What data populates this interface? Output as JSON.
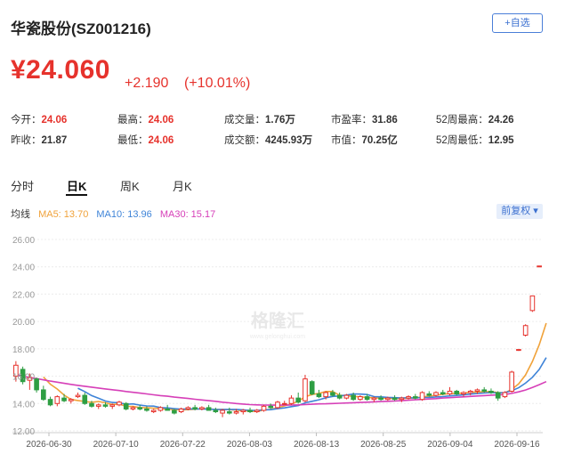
{
  "header": {
    "title": "华瓷股份(SZ001216)",
    "watch_button": "+自选"
  },
  "quote": {
    "price": "¥24.060",
    "change": "+2.190",
    "change_pct": "(+10.01%)"
  },
  "stats": {
    "open_label": "今开：",
    "open_value": "24.06",
    "high_label": "最高：",
    "high_value": "24.06",
    "volume_label": "成交量：",
    "volume_value": "1.76万",
    "pe_label": "市盈率：",
    "pe_value": "31.86",
    "wk52_high_label": "52周最高：",
    "wk52_high_value": "24.26",
    "prev_close_label": "昨收：",
    "prev_close_value": "21.87",
    "low_label": "最低：",
    "low_value": "24.06",
    "turnover_label": "成交额：",
    "turnover_value": "4245.93万",
    "mktcap_label": "市值：",
    "mktcap_value": "70.25亿",
    "wk52_low_label": "52周最低：",
    "wk52_low_value": "12.95"
  },
  "tabs": [
    "分时",
    "日K",
    "周K",
    "月K"
  ],
  "active_tab": "日K",
  "ma_legend": {
    "label": "均线",
    "ma5": "MA5: 13.70",
    "ma10": "MA10: 13.96",
    "ma30": "MA30: 15.17"
  },
  "adjust_button": "前复权",
  "watermark": "格隆汇",
  "watermark_sub": "www.gelonghui.com",
  "colors": {
    "up": "#e6322c",
    "down": "#2e9e43",
    "ma5": "#f0a23a",
    "ma10": "#3f84d8",
    "ma30": "#d63fb8",
    "accent": "#3a6fd0"
  },
  "chart_data": {
    "type": "candlestick",
    "ylim": [
      12,
      26
    ],
    "y_ticks": [
      "12.00",
      "14.00",
      "16.00",
      "18.00",
      "20.00",
      "22.00",
      "24.00",
      "26.00"
    ],
    "x_ticks": [
      "2026-06-30",
      "2026-07-10",
      "2026-07-22",
      "2026-08-03",
      "2026-08-13",
      "2026-08-25",
      "2026-09-04",
      "2026-09-16"
    ],
    "candles": [
      {
        "o": 16.0,
        "h": 17.1,
        "l": 15.6,
        "c": 16.8
      },
      {
        "o": 16.5,
        "h": 16.7,
        "l": 15.4,
        "c": 15.6
      },
      {
        "o": 15.7,
        "h": 16.2,
        "l": 15.0,
        "c": 15.9
      },
      {
        "o": 15.8,
        "h": 15.9,
        "l": 14.8,
        "c": 15.0
      },
      {
        "o": 15.0,
        "h": 15.3,
        "l": 14.2,
        "c": 14.3
      },
      {
        "o": 14.3,
        "h": 14.5,
        "l": 13.8,
        "c": 13.9
      },
      {
        "o": 14.0,
        "h": 14.6,
        "l": 13.8,
        "c": 14.5
      },
      {
        "o": 14.4,
        "h": 14.7,
        "l": 14.1,
        "c": 14.2
      },
      {
        "o": 14.2,
        "h": 14.4,
        "l": 14.0,
        "c": 14.3
      },
      {
        "o": 14.5,
        "h": 14.8,
        "l": 14.4,
        "c": 14.6
      },
      {
        "o": 14.6,
        "h": 14.8,
        "l": 13.9,
        "c": 14.0
      },
      {
        "o": 14.0,
        "h": 14.2,
        "l": 13.7,
        "c": 13.8
      },
      {
        "o": 13.8,
        "h": 14.0,
        "l": 13.6,
        "c": 13.9
      },
      {
        "o": 13.9,
        "h": 14.1,
        "l": 13.7,
        "c": 13.8
      },
      {
        "o": 13.8,
        "h": 14.0,
        "l": 13.6,
        "c": 13.9
      },
      {
        "o": 13.9,
        "h": 14.2,
        "l": 13.8,
        "c": 14.1
      },
      {
        "o": 14.0,
        "h": 14.1,
        "l": 13.5,
        "c": 13.6
      },
      {
        "o": 13.6,
        "h": 13.8,
        "l": 13.5,
        "c": 13.7
      },
      {
        "o": 13.7,
        "h": 13.9,
        "l": 13.5,
        "c": 13.6
      },
      {
        "o": 13.6,
        "h": 13.8,
        "l": 13.4,
        "c": 13.5
      },
      {
        "o": 13.4,
        "h": 13.6,
        "l": 13.3,
        "c": 13.5
      },
      {
        "o": 13.5,
        "h": 13.8,
        "l": 13.4,
        "c": 13.7
      },
      {
        "o": 13.6,
        "h": 13.9,
        "l": 13.5,
        "c": 13.5
      },
      {
        "o": 13.5,
        "h": 13.6,
        "l": 13.2,
        "c": 13.3
      },
      {
        "o": 13.4,
        "h": 13.7,
        "l": 13.3,
        "c": 13.6
      },
      {
        "o": 13.6,
        "h": 13.8,
        "l": 13.5,
        "c": 13.7
      },
      {
        "o": 13.7,
        "h": 13.9,
        "l": 13.5,
        "c": 13.6
      },
      {
        "o": 13.6,
        "h": 13.8,
        "l": 13.5,
        "c": 13.7
      },
      {
        "o": 13.7,
        "h": 13.9,
        "l": 13.5,
        "c": 13.5
      },
      {
        "o": 13.5,
        "h": 13.7,
        "l": 13.3,
        "c": 13.4
      },
      {
        "o": 13.3,
        "h": 13.6,
        "l": 13.0,
        "c": 13.5
      },
      {
        "o": 13.4,
        "h": 13.7,
        "l": 13.2,
        "c": 13.3
      },
      {
        "o": 13.3,
        "h": 13.6,
        "l": 13.2,
        "c": 13.4
      },
      {
        "o": 13.4,
        "h": 13.6,
        "l": 13.2,
        "c": 13.5
      },
      {
        "o": 13.5,
        "h": 13.7,
        "l": 13.3,
        "c": 13.4
      },
      {
        "o": 13.4,
        "h": 13.6,
        "l": 13.3,
        "c": 13.5
      },
      {
        "o": 13.5,
        "h": 13.9,
        "l": 13.4,
        "c": 13.8
      },
      {
        "o": 13.8,
        "h": 14.0,
        "l": 13.6,
        "c": 13.7
      },
      {
        "o": 13.7,
        "h": 14.2,
        "l": 13.6,
        "c": 14.1
      },
      {
        "o": 14.0,
        "h": 14.2,
        "l": 13.9,
        "c": 14.0
      },
      {
        "o": 14.0,
        "h": 14.6,
        "l": 13.9,
        "c": 14.4
      },
      {
        "o": 14.4,
        "h": 14.8,
        "l": 14.0,
        "c": 14.1
      },
      {
        "o": 14.2,
        "h": 16.1,
        "l": 14.1,
        "c": 15.8
      },
      {
        "o": 15.6,
        "h": 15.7,
        "l": 14.6,
        "c": 14.7
      },
      {
        "o": 14.7,
        "h": 15.0,
        "l": 14.4,
        "c": 14.5
      },
      {
        "o": 14.5,
        "h": 14.9,
        "l": 14.3,
        "c": 14.8
      },
      {
        "o": 14.8,
        "h": 15.0,
        "l": 14.5,
        "c": 14.6
      },
      {
        "o": 14.6,
        "h": 14.8,
        "l": 14.3,
        "c": 14.4
      },
      {
        "o": 14.4,
        "h": 14.7,
        "l": 14.3,
        "c": 14.6
      },
      {
        "o": 14.6,
        "h": 14.8,
        "l": 14.2,
        "c": 14.3
      },
      {
        "o": 14.3,
        "h": 14.6,
        "l": 14.2,
        "c": 14.5
      },
      {
        "o": 14.5,
        "h": 14.7,
        "l": 14.2,
        "c": 14.3
      },
      {
        "o": 14.3,
        "h": 14.5,
        "l": 14.1,
        "c": 14.4
      },
      {
        "o": 14.4,
        "h": 14.6,
        "l": 14.2,
        "c": 14.3
      },
      {
        "o": 14.3,
        "h": 14.5,
        "l": 14.2,
        "c": 14.4
      },
      {
        "o": 14.4,
        "h": 14.6,
        "l": 14.2,
        "c": 14.3
      },
      {
        "o": 14.3,
        "h": 14.5,
        "l": 14.1,
        "c": 14.4
      },
      {
        "o": 14.4,
        "h": 14.6,
        "l": 14.3,
        "c": 14.5
      },
      {
        "o": 14.5,
        "h": 14.7,
        "l": 14.3,
        "c": 14.4
      },
      {
        "o": 14.3,
        "h": 14.9,
        "l": 14.2,
        "c": 14.8
      },
      {
        "o": 14.7,
        "h": 14.9,
        "l": 14.5,
        "c": 14.6
      },
      {
        "o": 14.6,
        "h": 14.9,
        "l": 14.5,
        "c": 14.8
      },
      {
        "o": 14.8,
        "h": 15.0,
        "l": 14.6,
        "c": 14.7
      },
      {
        "o": 14.7,
        "h": 15.2,
        "l": 14.6,
        "c": 14.9
      },
      {
        "o": 14.9,
        "h": 15.0,
        "l": 14.6,
        "c": 14.7
      },
      {
        "o": 14.7,
        "h": 14.9,
        "l": 14.5,
        "c": 14.8
      },
      {
        "o": 14.8,
        "h": 15.0,
        "l": 14.6,
        "c": 14.9
      },
      {
        "o": 14.9,
        "h": 15.1,
        "l": 14.7,
        "c": 15.0
      },
      {
        "o": 15.0,
        "h": 15.2,
        "l": 14.8,
        "c": 14.9
      },
      {
        "o": 14.9,
        "h": 15.1,
        "l": 14.7,
        "c": 14.8
      },
      {
        "o": 14.8,
        "h": 14.9,
        "l": 14.2,
        "c": 14.4
      },
      {
        "o": 14.5,
        "h": 14.9,
        "l": 14.4,
        "c": 14.8
      },
      {
        "o": 14.9,
        "h": 16.4,
        "l": 14.8,
        "c": 16.3
      },
      {
        "o": 17.9,
        "h": 17.95,
        "l": 17.85,
        "c": 17.95
      },
      {
        "o": 19.0,
        "h": 19.8,
        "l": 18.9,
        "c": 19.7
      },
      {
        "o": 20.8,
        "h": 21.9,
        "l": 20.7,
        "c": 21.87
      },
      {
        "o": 24.06,
        "h": 24.06,
        "l": 24.06,
        "c": 24.06
      }
    ],
    "series": [
      {
        "name": "MA5",
        "values": [
          null,
          null,
          null,
          null,
          15.94,
          15.41,
          15.06,
          14.61,
          14.3,
          14.22,
          14.15,
          14.09,
          14.15,
          14.05,
          13.93,
          13.96,
          13.79,
          13.79,
          13.7,
          13.7,
          13.66,
          13.62,
          13.58,
          13.56,
          13.54,
          13.55,
          13.58,
          13.62,
          13.61,
          13.57,
          13.57,
          13.55,
          13.52,
          13.47,
          13.43,
          13.41,
          13.53,
          13.57,
          13.69,
          13.82,
          13.97,
          14.16,
          14.5,
          14.66,
          14.74,
          14.88,
          14.88,
          14.6,
          14.58,
          14.52,
          14.49,
          14.44,
          14.42,
          14.39,
          14.39,
          14.36,
          14.37,
          14.38,
          14.41,
          14.48,
          14.54,
          14.6,
          14.68,
          14.72,
          14.74,
          14.76,
          14.82,
          14.84,
          14.86,
          14.88,
          14.8,
          14.78,
          15.04,
          15.43,
          16.08,
          17.08,
          18.31,
          19.88
        ]
      },
      {
        "name": "MA10",
        "values": [
          null,
          null,
          null,
          null,
          null,
          null,
          null,
          null,
          null,
          15.12,
          14.87,
          14.58,
          14.38,
          14.18,
          14.08,
          14.06,
          13.94,
          13.97,
          13.88,
          13.82,
          13.81,
          13.7,
          13.68,
          13.63,
          13.58,
          13.61,
          13.6,
          13.6,
          13.59,
          13.56,
          13.56,
          13.57,
          13.57,
          13.54,
          13.5,
          13.49,
          13.54,
          13.55,
          13.62,
          13.68,
          13.77,
          13.85,
          14.05,
          14.16,
          14.27,
          14.42,
          14.52,
          14.55,
          14.62,
          14.7,
          14.69,
          14.66,
          14.51,
          14.49,
          14.45,
          14.43,
          14.4,
          14.42,
          14.41,
          14.44,
          14.45,
          14.48,
          14.51,
          14.56,
          14.59,
          14.63,
          14.69,
          14.73,
          14.77,
          14.8,
          14.78,
          14.8,
          14.94,
          15.15,
          15.49,
          15.92,
          16.5,
          17.36
        ]
      },
      {
        "name": "MA30",
        "values": [
          16.1,
          16.0,
          15.91,
          15.82,
          15.73,
          15.64,
          15.56,
          15.48,
          15.4,
          15.33,
          15.26,
          15.2,
          15.13,
          15.07,
          15.01,
          14.95,
          14.88,
          14.82,
          14.76,
          14.7,
          14.64,
          14.58,
          14.53,
          14.47,
          14.42,
          14.37,
          14.31,
          14.26,
          14.21,
          14.16,
          14.1,
          14.05,
          14.0,
          13.96,
          13.92,
          13.9,
          13.89,
          13.88,
          13.88,
          13.88,
          13.89,
          13.9,
          13.93,
          13.95,
          13.97,
          13.98,
          14.0,
          14.02,
          14.04,
          14.06,
          14.08,
          14.1,
          14.12,
          14.14,
          14.16,
          14.18,
          14.21,
          14.24,
          14.27,
          14.3,
          14.33,
          14.36,
          14.4,
          14.43,
          14.46,
          14.49,
          14.52,
          14.55,
          14.58,
          14.61,
          14.63,
          14.66,
          14.74,
          14.85,
          14.99,
          15.17,
          15.38,
          15.6
        ]
      }
    ]
  }
}
